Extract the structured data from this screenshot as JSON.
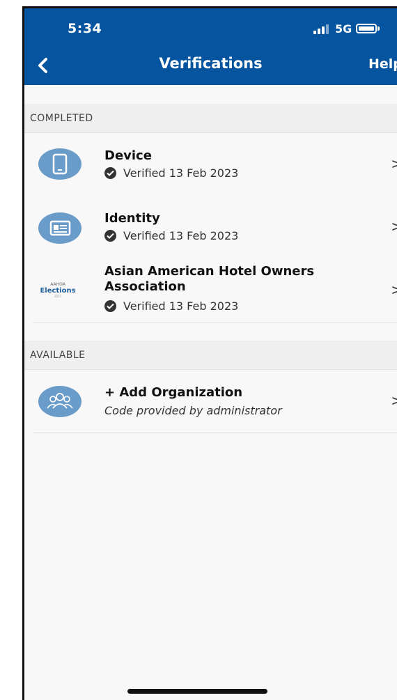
{
  "status_bar": {
    "time": "5:34",
    "network": "5G"
  },
  "nav": {
    "title": "Verifications",
    "help_label": "Help"
  },
  "sections": {
    "completed_label": "COMPLETED",
    "available_label": "AVAILABLE"
  },
  "completed_items": [
    {
      "title": "Device",
      "status": "Verified 13 Feb 2023",
      "icon": "phone-icon"
    },
    {
      "title": "Identity",
      "status": "Verified 13 Feb 2023",
      "icon": "id-card-icon"
    },
    {
      "title_line1": "Asian American Hotel Owners",
      "title_line2": "Association",
      "status": "Verified 13 Feb 2023",
      "logo_top": "AAHOA",
      "logo_main": "Elections",
      "logo_bottom": "2023"
    }
  ],
  "available_items": [
    {
      "title": "+ Add Organization",
      "subtitle": "Code provided by administrator",
      "icon": "group-icon"
    }
  ],
  "colors": {
    "brand": "#0454a0",
    "icon_bg": "#6a9cc9"
  }
}
